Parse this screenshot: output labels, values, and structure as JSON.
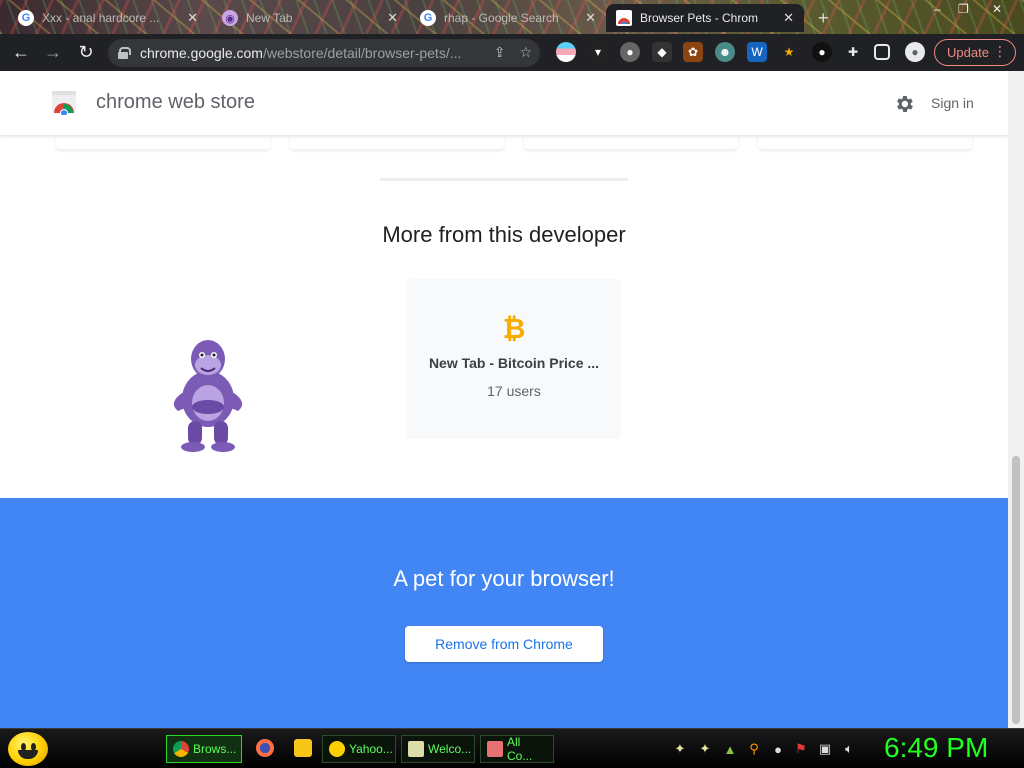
{
  "browser": {
    "tabs": [
      {
        "title": "Xxx - anal hardcore ...",
        "icon": "google-icon",
        "active": false
      },
      {
        "title": "New Tab",
        "icon": "newtab-icon",
        "active": false
      },
      {
        "title": "rhap - Google Search",
        "icon": "google-icon",
        "active": false
      },
      {
        "title": "Browser Pets - Chrome W",
        "icon": "webstore-icon",
        "active": true
      }
    ],
    "new_tab_label": "+",
    "window_controls": {
      "minimize": "–",
      "restore": "❐",
      "close": "✕"
    },
    "address": {
      "host": "chrome.google.com",
      "path": "/webstore/detail/browser-pets/..."
    },
    "update_label": "Update",
    "menu_label": "⋮"
  },
  "store": {
    "title": "chrome web store",
    "sign_in": "Sign in"
  },
  "developer_section": {
    "heading": "More from this developer",
    "card": {
      "name": "New Tab - Bitcoin Price ...",
      "users": "17 users",
      "icon_glyph": "₿"
    }
  },
  "banner": {
    "tagline": "A pet for your browser!",
    "button": "Remove from Chrome"
  },
  "taskbar": {
    "items": [
      {
        "label": "Brows...",
        "active": true
      },
      {
        "label": "Yahoo...",
        "active": false
      },
      {
        "label": "Welco...",
        "active": false
      },
      {
        "label": "All Co...",
        "active": false
      }
    ],
    "clock": "6:49 PM"
  },
  "colors": {
    "banner": "#4285f4",
    "button_text": "#1a73e8",
    "update": "#f28b82",
    "clock": "#22ff22",
    "pet": "#7b5bb6"
  }
}
